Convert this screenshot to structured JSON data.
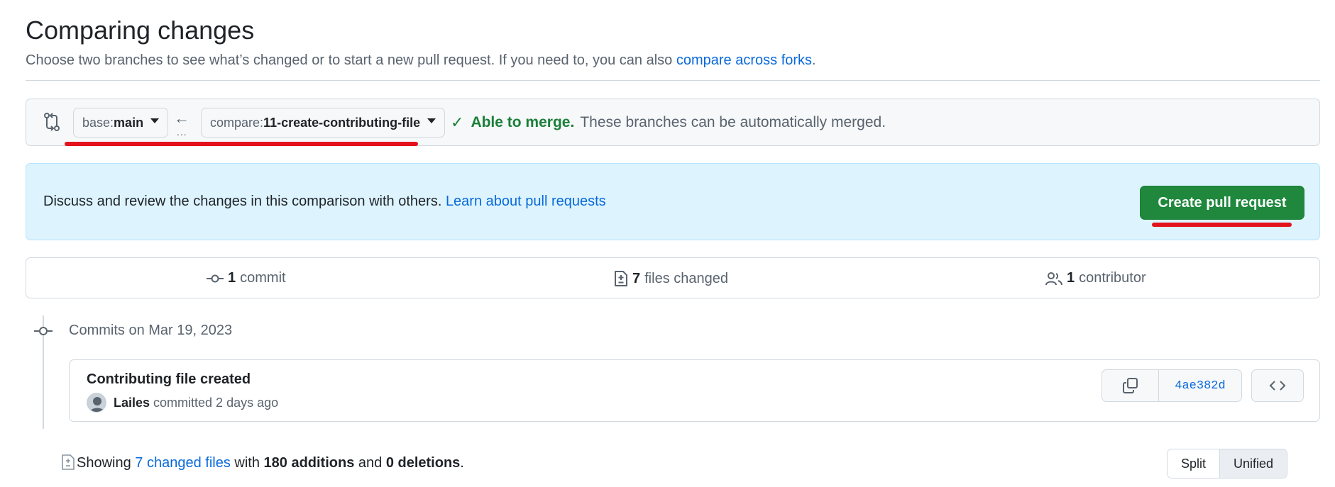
{
  "page": {
    "title": "Comparing changes",
    "subtitle_prefix": "Choose two branches to see what’s changed or to start a new pull request. If you need to, you can also ",
    "subtitle_link": "compare across forks",
    "subtitle_suffix": "."
  },
  "range": {
    "base_prefix": "base: ",
    "base_branch": "main",
    "arrow": "←",
    "dots": "...",
    "compare_prefix": "compare: ",
    "compare_branch": "11-create-contributing-file",
    "check": "✓",
    "merge_ok": "Able to merge.",
    "merge_msg": "These branches can be automatically merged."
  },
  "banner": {
    "text": "Discuss and review the changes in this comparison with others. ",
    "link": "Learn about pull requests",
    "button": "Create pull request"
  },
  "stats": {
    "commits_count": "1",
    "commits_label": "commit",
    "files_count": "7",
    "files_label": "files changed",
    "contributors_count": "1",
    "contributors_label": "contributor"
  },
  "timeline": {
    "date_heading": "Commits on Mar 19, 2023"
  },
  "commit": {
    "title": "Contributing file created",
    "author": "Lailes",
    "meta": " committed 2 days ago",
    "sha": "4ae382d"
  },
  "summary": {
    "prefix": "Showing ",
    "files_link": "7 changed files",
    "with": " with ",
    "additions": "180 additions",
    "and": " and ",
    "deletions": "0 deletions",
    "end": "."
  },
  "view": {
    "split": "Split",
    "unified": "Unified",
    "selected": "Unified"
  },
  "colors": {
    "accent_link": "#0969da",
    "success": "#1a7f37",
    "primary_button": "#1f883d",
    "annotation_red": "#e3121c",
    "banner_bg": "#ddf4ff"
  }
}
